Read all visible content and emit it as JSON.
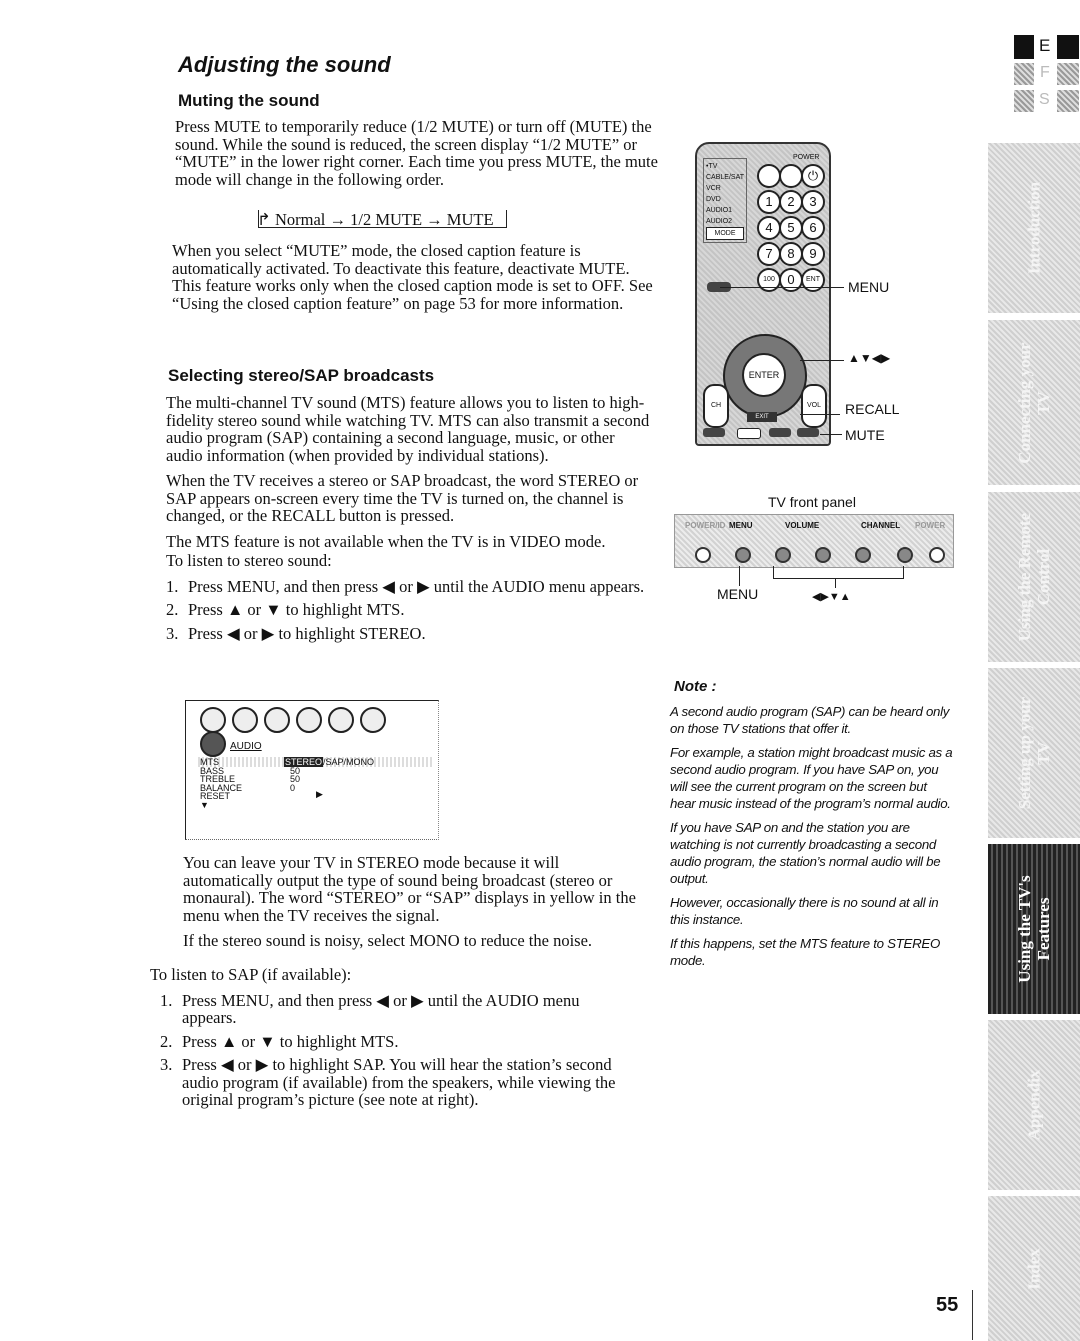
{
  "title": "Adjusting the sound",
  "muting": {
    "heading": "Muting the sound",
    "para1": "Press MUTE to temporarily reduce (1/2 MUTE) or turn off (MUTE) the sound. While the sound is reduced, the screen display “1/2 MUTE” or “MUTE” in the lower right corner. Each time you press MUTE, the mute mode will change in the following order.",
    "sequence": "Normal → 1/2 MUTE → MUTE",
    "para2": "When you select “MUTE” mode, the closed caption feature is automatically activated. To deactivate this feature, deactivate MUTE. This feature works only when the closed caption mode is set to OFF. See “Using the closed caption feature” on page 53 for more information."
  },
  "stereo": {
    "heading": "Selecting stereo/SAP broadcasts",
    "paras": [
      "The multi-channel TV sound (MTS) feature allows you to listen to high-fidelity stereo sound while watching TV. MTS can also transmit a second audio program (SAP) containing a second language, music, or other audio information (when provided by individual stations).",
      "When the TV receives a stereo or SAP broadcast, the word STEREO or SAP appears on-screen every time the TV is turned on, the channel is changed, or the RECALL button is pressed.",
      "The MTS feature is not available when the TV is in VIDEO mode."
    ],
    "stereo_intro": "To listen to stereo sound:",
    "stereo_steps": [
      {
        "n": "1.",
        "text": "Press MENU, and then press ◀ or ▶ until the AUDIO menu appears."
      },
      {
        "n": "2.",
        "text": "Press ▲ or ▼ to highlight MTS."
      },
      {
        "n": "3.",
        "text": "Press ◀ or ▶ to highlight STEREO."
      }
    ],
    "after_paras": [
      "You can leave your TV in STEREO mode because it will automatically output the type of sound being broadcast (stereo or monaural). The word “STEREO” or “SAP” displays in yellow in the menu when the TV receives the signal.",
      "If the stereo sound is noisy, select MONO to reduce the noise."
    ],
    "sap_intro": "To listen to SAP (if available):",
    "sap_steps": [
      {
        "n": "1.",
        "text": "Press MENU, and then press ◀ or ▶ until the AUDIO menu appears."
      },
      {
        "n": "2.",
        "text": "Press ▲ or ▼ to highlight MTS."
      },
      {
        "n": "3.",
        "text": "Press ◀ or ▶ to highlight SAP. You will hear the station’s second audio program (if available) from the speakers, while viewing the original program’s picture (see note at right)."
      }
    ]
  },
  "osd_menu": {
    "title": "AUDIO",
    "items": [
      "MTS",
      "BASS",
      "TREBLE",
      "BALANCE",
      "RESET"
    ],
    "values": [
      "",
      "50",
      "50",
      "0",
      ""
    ],
    "mts_options": [
      "STEREO",
      "SAP",
      "MONO"
    ],
    "selected": "STEREO"
  },
  "remote": {
    "mode_labels": [
      "•TV",
      "CABLE/SAT",
      "VCR",
      "DVD",
      "AUDIO1",
      "AUDIO2"
    ],
    "mode_button": "MODE",
    "power": "POWER",
    "digits": [
      "1",
      "2",
      "3",
      "4",
      "5",
      "6",
      "7",
      "8",
      "9",
      "100",
      "0",
      "ENT"
    ],
    "enter": "ENTER",
    "exit": "EXIT",
    "ch": "CH",
    "vol": "VOL",
    "callouts": [
      "MENU",
      "▲▼◀▶",
      "RECALL",
      "MUTE"
    ]
  },
  "front_panel": {
    "caption": "TV front panel",
    "labels": [
      "POWER/ID",
      "MENU",
      "VOLUME",
      "CHANNEL",
      "POWER"
    ],
    "callouts": [
      "MENU",
      "◀▶▼▲"
    ]
  },
  "note": {
    "title": "Note :",
    "paras": [
      "A second audio program (SAP) can be heard only on those TV stations that offer it.",
      "For example, a station might broadcast music as a second audio program. If you have SAP on, you will see the current program on the screen but hear music instead of the program’s normal audio.",
      "If you have SAP on and the station you are watching is not currently broadcasting a second audio program, the station’s normal audio will be output.",
      "However, occasionally there is no sound at all in this instance.",
      "If this happens, set the MTS feature to STEREO mode."
    ]
  },
  "language_tabs": [
    "E",
    "F",
    "S"
  ],
  "active_language": "E",
  "side_tabs": [
    "Introduction",
    "Connecting your TV",
    "Using the Remote Control",
    "Setting up your TV",
    "Using the TV's Features",
    "Appendix",
    "Index"
  ],
  "active_tab": "Using the TV's Features",
  "page_number": "55"
}
